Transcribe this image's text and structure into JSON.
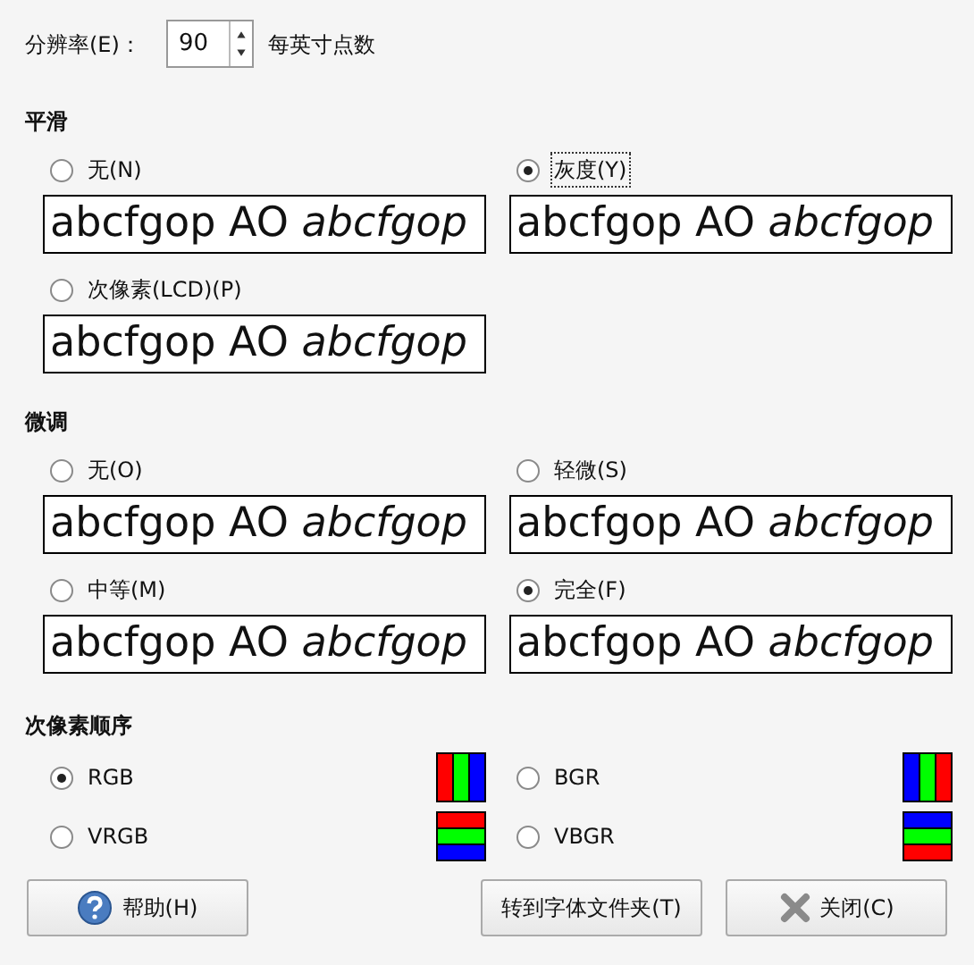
{
  "resolution": {
    "label": "分辨率(E)：",
    "value": "90",
    "unit": "每英寸点数"
  },
  "smoothing": {
    "title": "平滑",
    "options": [
      {
        "label": "无(N)",
        "selected": false,
        "focused": false,
        "sample": "abcfgop AO *abcfgop*"
      },
      {
        "label": "灰度(Y)",
        "selected": true,
        "focused": true,
        "sample": "abcfgop AO *abcfgop*"
      },
      {
        "label": "次像素(LCD)(P)",
        "selected": false,
        "focused": false,
        "sample": "abcfgop AO *abcfgop*"
      }
    ]
  },
  "hinting": {
    "title": "微调",
    "options": [
      {
        "label": "无(O)",
        "selected": false,
        "focused": false,
        "sample": "abcfgop AO *abcfgop*"
      },
      {
        "label": "轻微(S)",
        "selected": false,
        "focused": false,
        "sample": "abcfgop AO *abcfgop*"
      },
      {
        "label": "中等(M)",
        "selected": false,
        "focused": false,
        "sample": "abcfgop AO *abcfgop*"
      },
      {
        "label": "完全(F)",
        "selected": true,
        "focused": false,
        "sample": "abcfgop AO *abcfgop*"
      }
    ]
  },
  "subpixel": {
    "title": "次像素顺序",
    "options": [
      {
        "label": "RGB",
        "selected": true,
        "kind": "rgb"
      },
      {
        "label": "BGR",
        "selected": false,
        "kind": "bgr"
      },
      {
        "label": "VRGB",
        "selected": false,
        "kind": "vrgb"
      },
      {
        "label": "VBGR",
        "selected": false,
        "kind": "vbgr"
      }
    ]
  },
  "buttons": [
    {
      "label": "帮助(H)",
      "kind": "help"
    },
    {
      "label": "转到字体文件夹(T)",
      "kind": "folder"
    },
    {
      "label": "关闭(C)",
      "kind": "close"
    }
  ]
}
